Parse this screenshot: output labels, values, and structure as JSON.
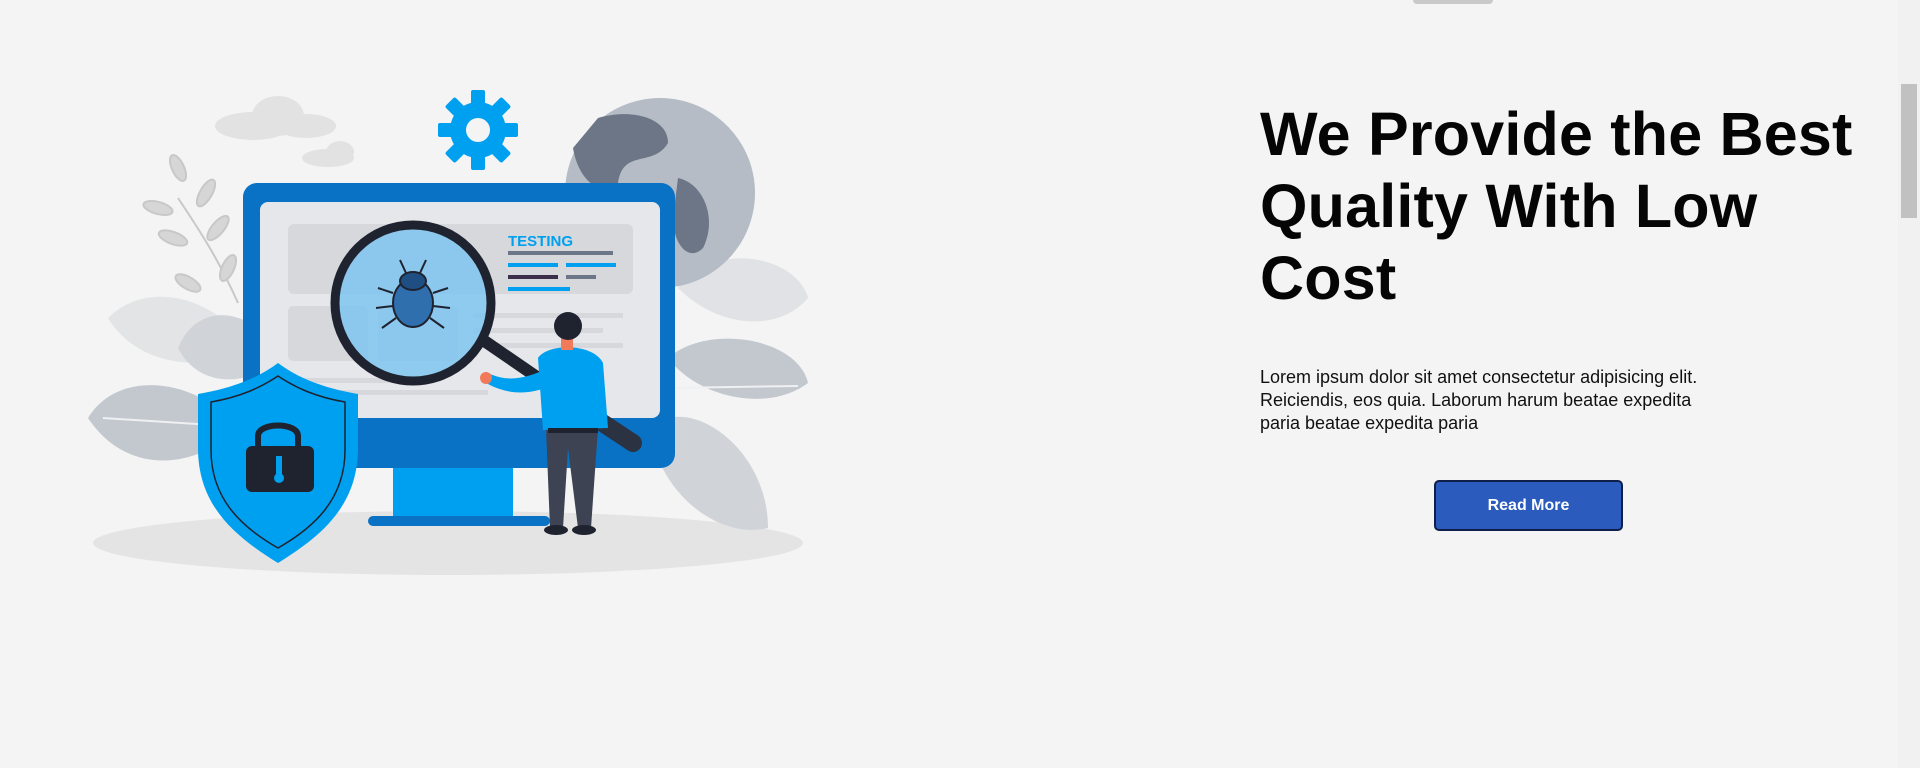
{
  "hero": {
    "title_lines": [
      "We Provide the Best",
      "Quality With Low",
      "Cost"
    ],
    "description_lines": [
      "Lorem ipsum dolor sit amet consectetur adipisicing elit.",
      "Reiciendis, eos quia. Laborum harum beatae expedita",
      "paria beatae expedita paria"
    ],
    "cta_label": "Read More"
  },
  "illustration": {
    "screen_label": "TESTING",
    "icons": [
      "gear-icon",
      "globe-icon",
      "shield-lock-icon",
      "magnifier-icon",
      "bug-icon"
    ]
  },
  "colors": {
    "background": "#f4f4f4",
    "accent_blue": "#00a0f0",
    "monitor_blue": "#0a72c4",
    "button_blue": "#2a5bbd",
    "heading_text": "#050505"
  }
}
